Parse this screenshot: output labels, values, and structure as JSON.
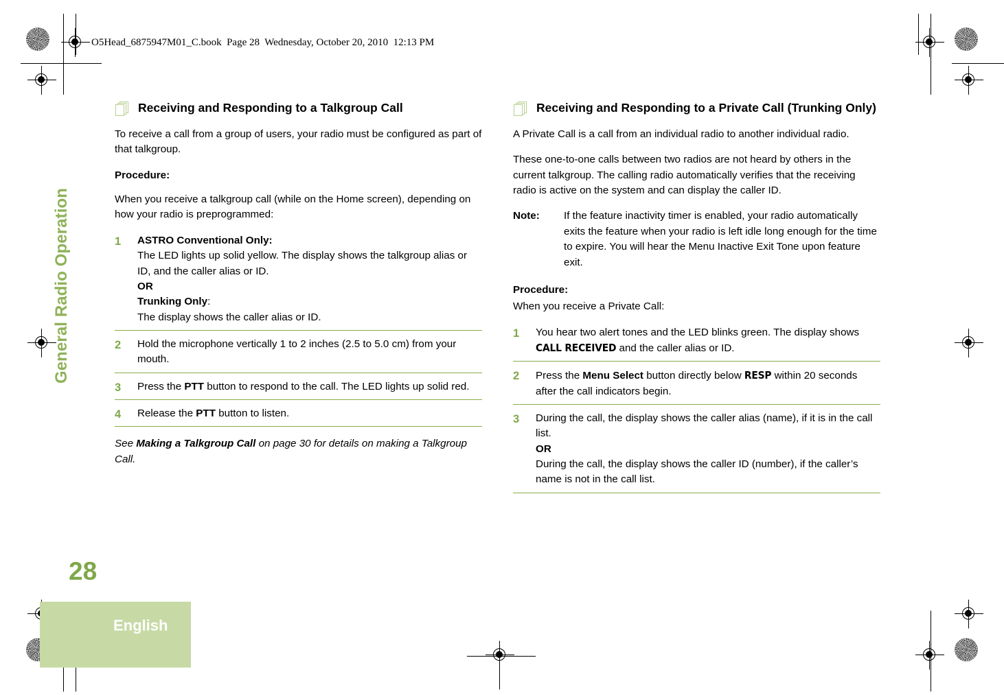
{
  "book_header": "O5Head_6875947M01_C.book  Page 28  Wednesday, October 20, 2010  12:13 PM",
  "sidebar": {
    "chapter_title": "General Radio Operation",
    "page_number": "28",
    "language": "English"
  },
  "colors": {
    "rule_green": "#8aab4a",
    "number_green": "#7fa84a",
    "tab_green": "#c7daa5",
    "icon_green": "#b6cf8d"
  },
  "left_column": {
    "heading": "Receiving and Responding to a Talkgroup Call",
    "intro": "To receive a call from a group of users, your radio must be configured as part of that talkgroup.",
    "procedure_label": "Procedure:",
    "procedure_intro": "When you receive a talkgroup call (while on the Home screen), depending on how your radio is preprogrammed:",
    "steps": [
      {
        "lead_bold": "ASTRO Conventional Only:",
        "line1": "The LED lights up solid yellow. The display shows the talkgroup alias or ID, and the caller alias or ID.",
        "or": "OR",
        "lead_bold2": "Trunking Only",
        "lead_bold2_suffix": ":",
        "line2": "The display shows the caller alias or ID."
      },
      {
        "text": "Hold the microphone vertically 1 to 2 inches (2.5 to 5.0 cm) from your mouth."
      },
      {
        "pre": "Press the ",
        "bold": "PTT",
        "post": " button to respond to the call. The LED lights up solid red."
      },
      {
        "pre": "Release the ",
        "bold": "PTT",
        "post": " button to listen."
      }
    ],
    "see_also": {
      "pre": "See ",
      "bold": "Making a Talkgroup Call",
      "post": " on page 30 for details on making a Talkgroup Call."
    }
  },
  "right_column": {
    "heading_line1": "Receiving and Responding to a Private Call",
    "heading_line2": "(Trunking Only)",
    "para1": "A Private Call is a call from an individual radio to another individual radio.",
    "para2": "These one-to-one calls between two radios are not heard by others in the current talkgroup. The calling radio automatically verifies that the receiving radio is active on the system and can display the caller ID.",
    "note_label": "Note:",
    "note_text": "If the feature inactivity timer is enabled, your radio automatically exits the feature when your radio is left idle long enough for the time to expire. You will hear the Menu Inactive Exit Tone upon feature exit.",
    "procedure_label": "Procedure:",
    "procedure_intro": "When you receive a Private Call:",
    "steps": [
      {
        "pre": "You hear two alert tones and the LED blinks green. The display shows ",
        "lcd": "CALL RECEIVED",
        "post": " and the caller alias or ID."
      },
      {
        "pre": "Press the ",
        "bold": "Menu Select",
        "mid": " button directly below ",
        "lcd": "RESP",
        "post": " within 20 seconds after the call indicators begin."
      },
      {
        "line1": "During the call, the display shows the caller alias (name), if it is in the call list.",
        "or": "OR",
        "line2": "During the call, the display shows the caller ID (number), if the caller’s name is not in the call list."
      }
    ]
  }
}
